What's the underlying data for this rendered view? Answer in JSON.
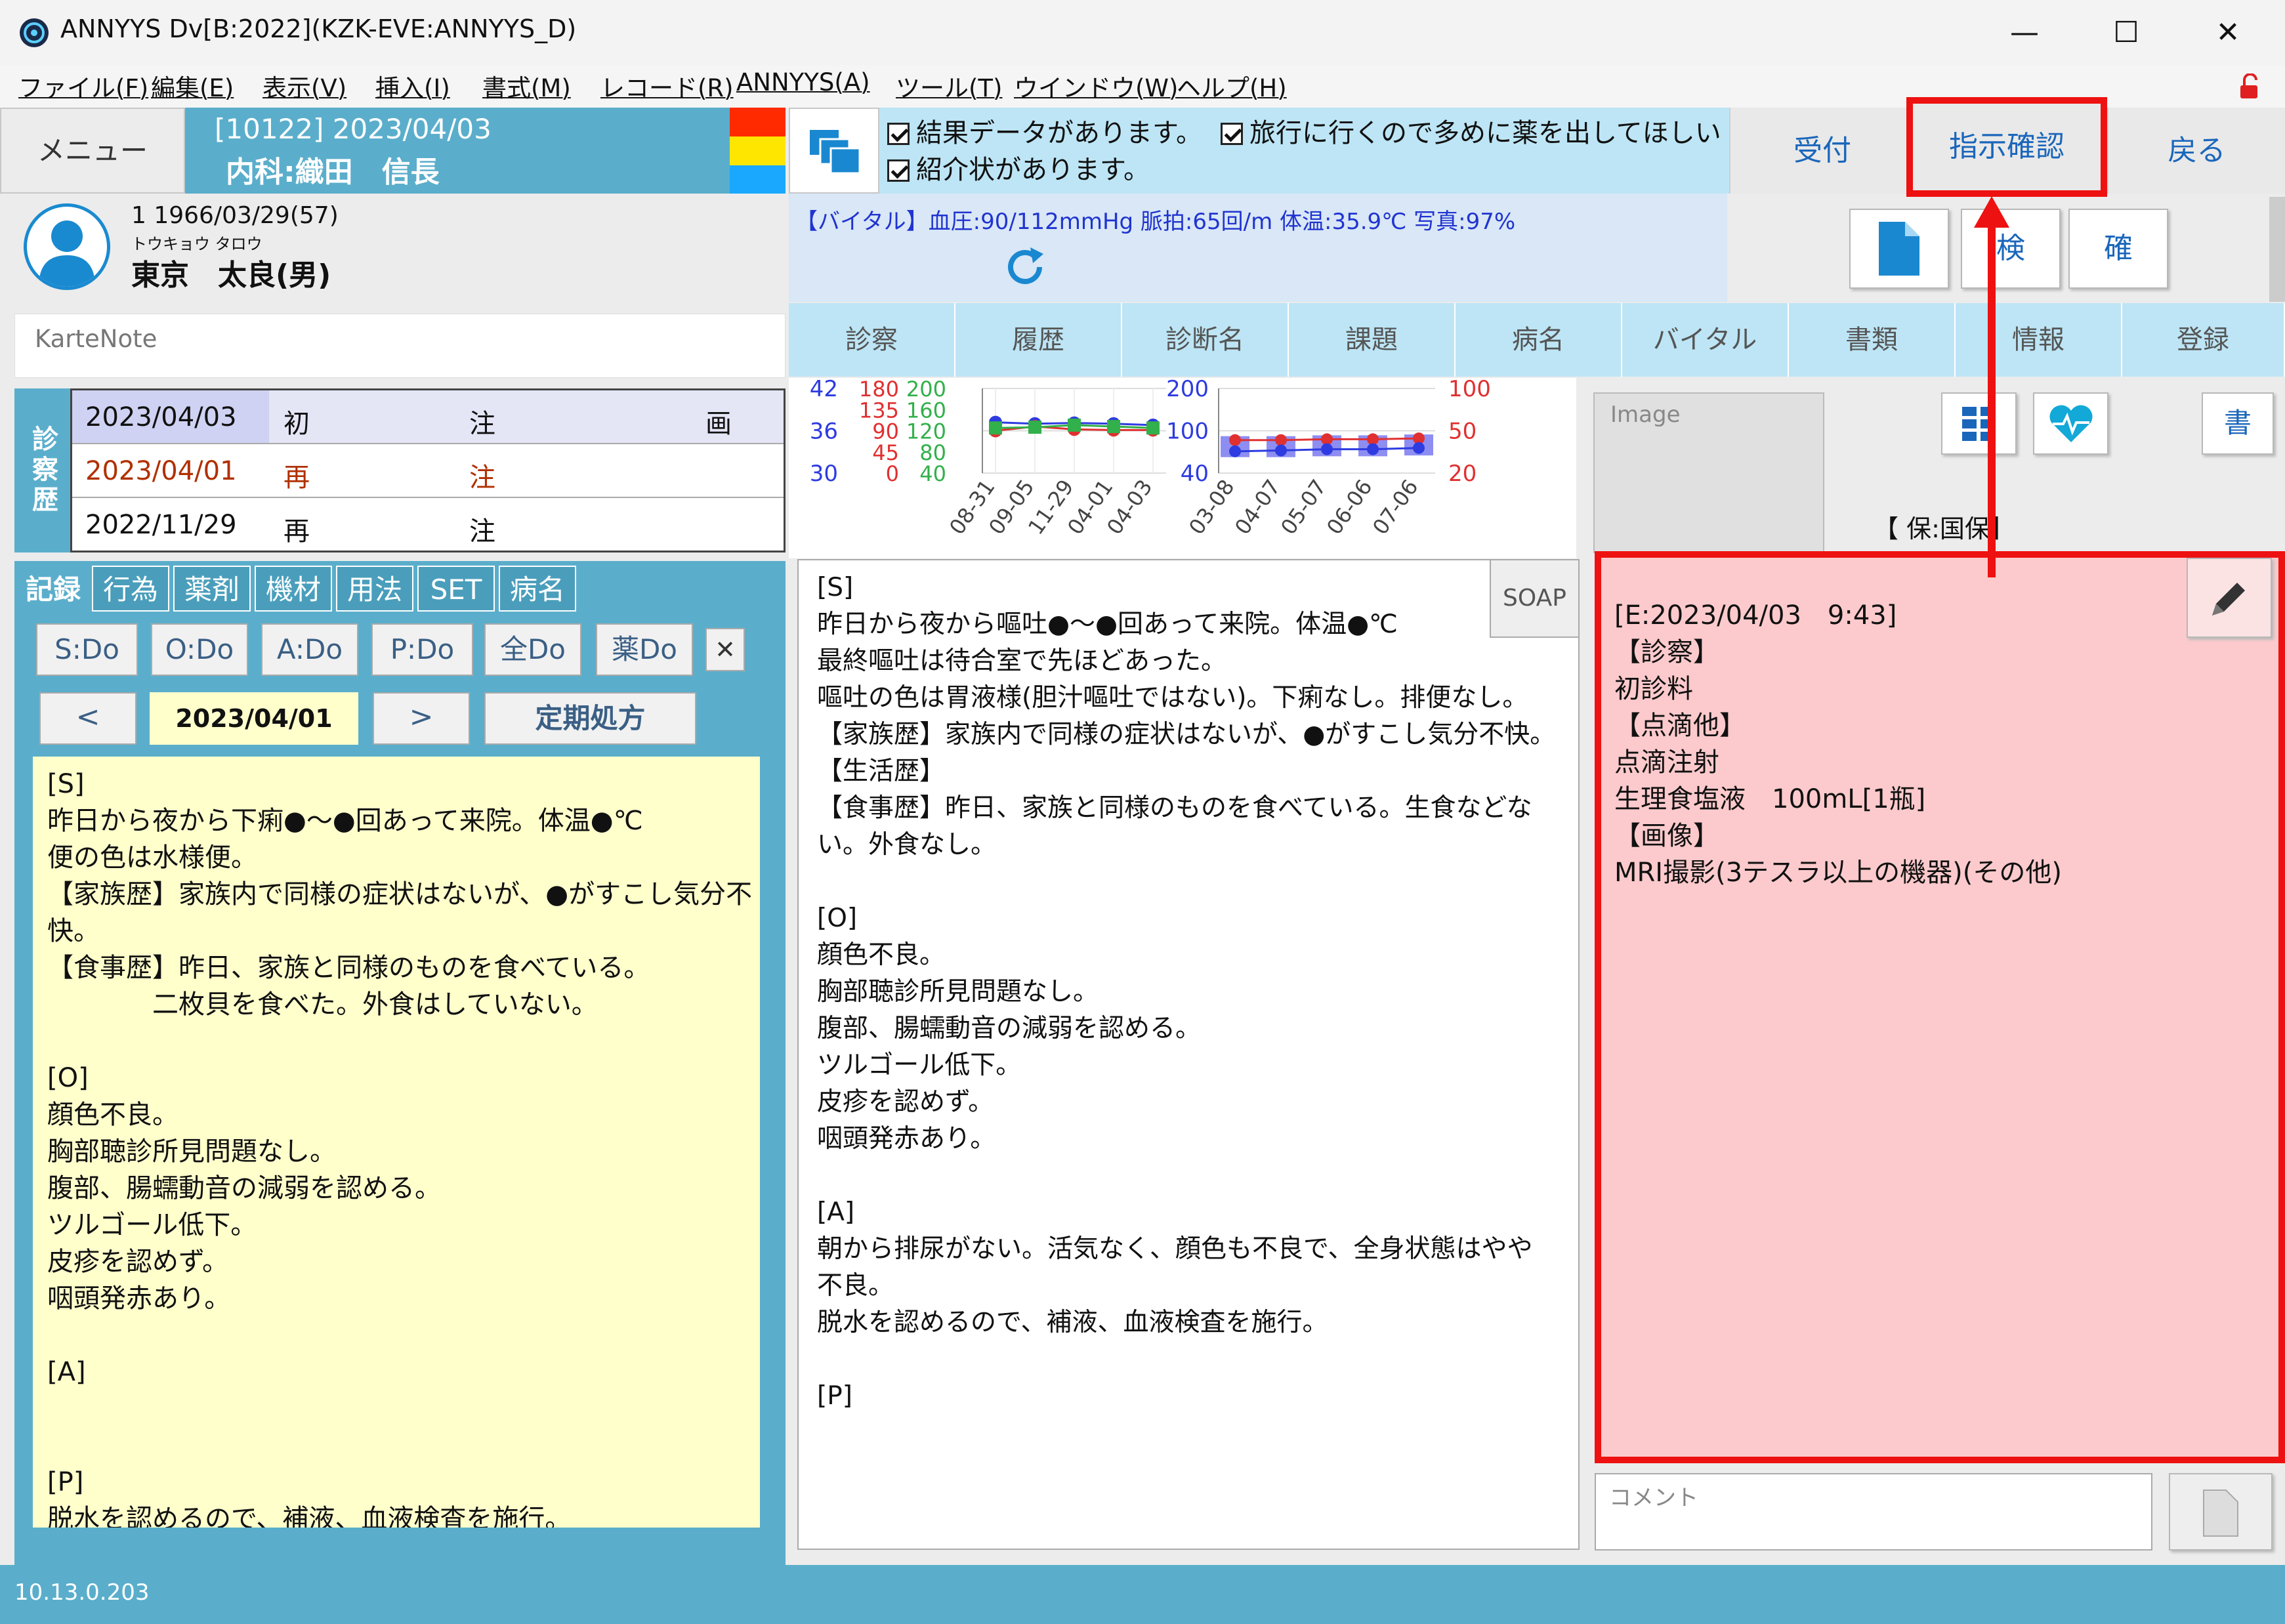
{
  "window": {
    "title": "ANNYYS Dv[B:2022](KZK-EVE:ANNYYS_D)",
    "minimize": "—",
    "maximize": "☐",
    "close": "✕"
  },
  "menubar": [
    "ファイル(F)",
    "編集(E)",
    "表示(V)",
    "挿入(I)",
    "書式(M)",
    "レコード(R)",
    "ANNYYS(A)",
    "ツール(T)",
    "ウインドウ(W)",
    "ヘルプ(H)"
  ],
  "header": {
    "menu_label": "メニュー",
    "visit_line1": "[10122] 2023/04/03",
    "visit_line2": "内科:織田　信長",
    "notices": [
      "結果データがあります。",
      "旅行に行くので多めに薬を出してほしい",
      "紹介状があります。"
    ],
    "buttons": [
      "受付",
      "指示確認",
      "戻る"
    ]
  },
  "patient": {
    "line1": "1  1966/03/29(57)",
    "kana": "トウキョウ  タロウ",
    "name": "東京　太良(男)"
  },
  "karte_note_placeholder": "KarteNote",
  "vitals": {
    "text": "【バイタル】血圧:90/112mmHg  脈拍:65回/m  体温:35.9℃  写真:97%"
  },
  "action_buttons": [
    "検",
    "確"
  ],
  "tabs": [
    "診察",
    "履歴",
    "診断名",
    "課題",
    "病名",
    "バイタル",
    "書類",
    "情報",
    "登録"
  ],
  "history": {
    "side_label": "診察歴",
    "rows": [
      {
        "date": "2023/04/03",
        "type": "初",
        "c2": "注",
        "c3": "画"
      },
      {
        "date": "2023/04/01",
        "type": "再",
        "c2": "注",
        "c3": ""
      },
      {
        "date": "2022/11/29",
        "type": "再",
        "c2": "注",
        "c3": ""
      }
    ]
  },
  "left_tabs": [
    "記録",
    "行為",
    "薬剤",
    "機材",
    "用法",
    "SET",
    "病名"
  ],
  "do_buttons": [
    "S:Do",
    "O:Do",
    "A:Do",
    "P:Do",
    "全Do",
    "薬Do"
  ],
  "close_x": "✕",
  "nav": {
    "prev": "<",
    "date": "2023/04/01",
    "next": ">",
    "regular_rx": "定期処方"
  },
  "left_note": "[S]\n昨日から夜から下痢●～●回あって来院。体温●℃\n便の色は水様便。\n【家族歴】家族内で同様の症状はないが、●がすこし気分不\n快。\n【食事歴】昨日、家族と同様のものを食べている。\n　　　　二枚貝を食べた。外食はしていない。\n\n[O]\n顔色不良。\n胸部聴診所見問題なし。\n腹部、腸蠕動音の減弱を認める。\nツルゴール低下。\n皮疹を認めず。\n咽頭発赤あり。\n\n[A]\n\n\n[P]\n脱水を認めるので、補液、血液検査を施行。",
  "mid_note": "[S]\n昨日から夜から嘔吐●～●回あって来院。体温●℃\n最終嘔吐は待合室で先ほどあった。\n嘔吐の色は胃液様(胆汁嘔吐ではない)。下痢なし。排便なし。\n【家族歴】家族内で同様の症状はないが、●がすこし気分不快。\n【生活歴】\n【食事歴】昨日、家族と同様のものを食べている。生食などな\nい。外食なし。\n\n[O]\n顔色不良。\n胸部聴診所見問題なし。\n腹部、腸蠕動音の減弱を認める。\nツルゴール低下。\n皮疹を認めず。\n咽頭発赤あり。\n\n[A]\n朝から排尿がない。活気なく、顔色も不良で、全身状態はやや\n不良。\n脱水を認めるので、補液、血液検査を施行。\n\n[P]",
  "soap_label": "SOAP",
  "image_label": "Image",
  "ins_label": "【 保:国保】",
  "order_text": "[E:2023/04/03　9:43]\n【診察】\n初診料\n【点滴他】\n点滴注射\n生理食塩液　100mL[1瓶]\n【画像】\nMRI撮影(3テスラ以上の機器)(その他)",
  "comment_placeholder": "コメント",
  "status": "10.13.0.203",
  "colors": {
    "accent": "#5aaecb",
    "notice_bg": "#bde5f5",
    "highlight": "#ee1111",
    "order_bg": "#fccacc",
    "note_bg": "#ffffcc"
  },
  "chart_data": [
    {
      "type": "line",
      "x": [
        "08-31",
        "09-05",
        "11-29",
        "04-01",
        "04-03"
      ],
      "y_ticks_left": [
        "42",
        "36",
        "30"
      ],
      "y_ticks_mid": [
        "180",
        "135",
        "90",
        "45",
        "0"
      ],
      "y_ticks_right": [
        "200",
        "160",
        "120",
        "80",
        "40"
      ],
      "series": [
        {
          "name": "",
          "values": [
            37.2,
            37.0,
            37.1,
            37.0,
            36.8
          ],
          "color": "#2d3be0"
        },
        {
          "name": "",
          "values": [
            36.0,
            36.6,
            36.2,
            36.1,
            36.1
          ],
          "color": "#e03030"
        },
        {
          "name": "",
          "values": [
            36.4,
            36.5,
            36.8,
            36.6,
            36.4
          ],
          "color": "#32b04b"
        }
      ]
    },
    {
      "type": "line",
      "x": [
        "03-08",
        "04-07",
        "05-07",
        "06-06",
        "07-06"
      ],
      "y_ticks_left": [
        "200",
        "100",
        "40"
      ],
      "y_ticks_right": [
        "100",
        "50",
        "20"
      ],
      "series": [
        {
          "name": "",
          "values": [
            78,
            78,
            80,
            80,
            82
          ],
          "color": "#e03030"
        },
        {
          "name": "",
          "values": [
            70,
            72,
            75,
            75,
            78
          ],
          "color": "#2d3be0"
        }
      ]
    }
  ]
}
